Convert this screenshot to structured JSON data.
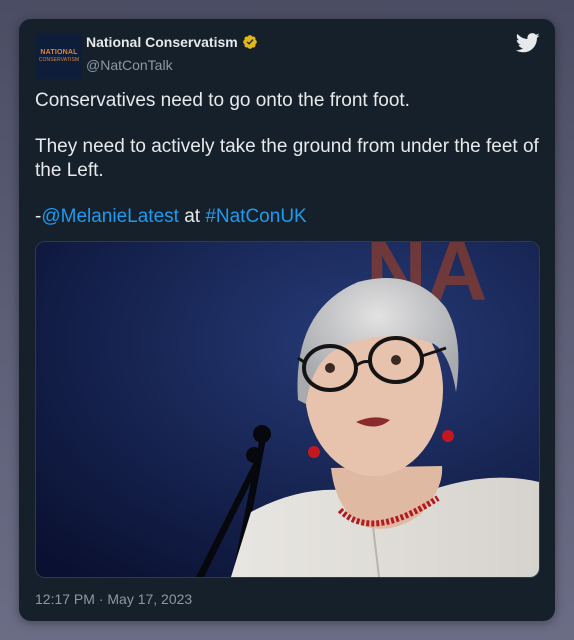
{
  "tweet": {
    "author": {
      "name": "National Conservatism",
      "handle": "@NatConTalk",
      "avatar_text_line1": "NATIONAL",
      "avatar_text_line2": "CONSERVATISM",
      "verified": true
    },
    "body": {
      "line1": "Conservatives need to go onto the front foot.",
      "line2": "They need to actively take the ground from under the feet of the Left.",
      "attribution_prefix": "-",
      "mention": "@MelanieLatest",
      "attribution_middle": " at ",
      "hashtag": "#NatConUK"
    },
    "media": {
      "background_text": "NA"
    },
    "timestamp": "12:17 PM · May 17, 2023"
  },
  "colors": {
    "card_bg": "#15202b",
    "link": "#1d9bf0",
    "text_primary": "#e7e9ea",
    "text_secondary": "#8b98a5",
    "verified_badge": "#e2b719",
    "accent_orange": "#d7893a"
  },
  "icons": [
    "verified-badge-icon",
    "twitter-bird-icon"
  ]
}
